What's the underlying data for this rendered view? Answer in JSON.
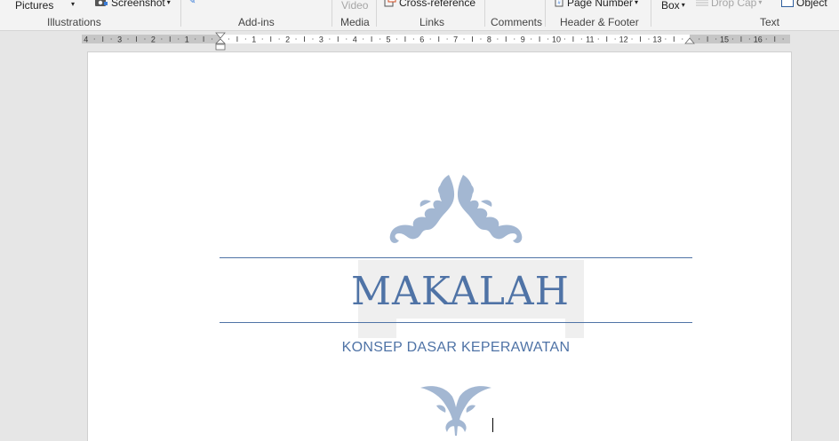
{
  "ribbon": {
    "items": {
      "pictures": "Pictures",
      "screenshot": "Screenshot",
      "video": "Video",
      "cross_reference": "Cross-reference",
      "page_number": "Page Number",
      "box": "Box",
      "drop_cap": "Drop Cap",
      "object": "Object"
    },
    "groups": {
      "illustrations": "Illustrations",
      "addins": "Add-ins",
      "media": "Media",
      "links": "Links",
      "comments": "Comments",
      "header_footer": "Header & Footer",
      "text": "Text"
    }
  },
  "ruler": {
    "left_labels": [
      "4",
      "3",
      "2",
      "1"
    ],
    "right_labels": [
      "1",
      "2",
      "3",
      "4",
      "5",
      "6",
      "7",
      "8",
      "9",
      "10",
      "11",
      "12",
      "13",
      "15",
      "16"
    ]
  },
  "document": {
    "title": "MAKALAH",
    "subtitle": "KONSEP DASAR KEPERAWATAN"
  },
  "colors": {
    "accent": "#4f73a6",
    "ornament": "#a3b7d2"
  }
}
